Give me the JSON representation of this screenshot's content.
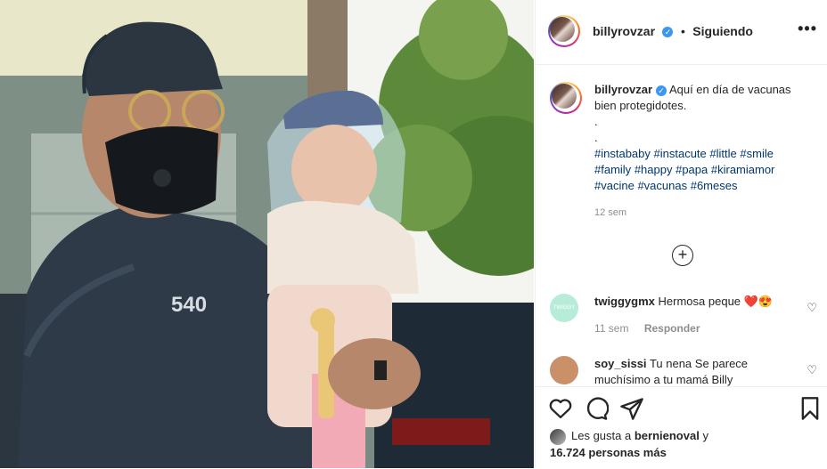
{
  "post": {
    "username": "billyrovzar",
    "follow_separator": "•",
    "follow_label": "Siguiendo",
    "more_label": "•••",
    "caption": "Aquí en día de vacunas bien protegidotes.",
    "caption_dots": [
      ".",
      "."
    ],
    "hashtags": [
      "#instababy",
      "#instacute",
      "#little",
      "#smile",
      "#family",
      "#happy",
      "#papa",
      "#kiramiamor",
      "#vacine",
      "#vacunas",
      "#6meses"
    ],
    "caption_time": "12 sem",
    "photo_text": "540"
  },
  "comments": [
    {
      "username": "twiggygmx",
      "text": "Hermosa peque",
      "emoji": "❤️😍",
      "time": "11 sem",
      "reply_label": "Responder",
      "avatar_color": "#b7ecd9",
      "avatar_text": "TWIGGY"
    },
    {
      "username": "soy_sissi",
      "text": "Tu nena Se parece muchísimo a tu mamá Billy",
      "avatar_color": "#c9906a"
    }
  ],
  "actions": {
    "icons": [
      "heart-icon",
      "comment-icon",
      "share-icon",
      "save-icon"
    ],
    "likes_prefix": "Les gusta a",
    "likes_user": "bernienoval",
    "likes_join": "y",
    "likes_count": "16.724 personas más"
  },
  "colors": {
    "accent_link": "#00376b",
    "verified": "#3897f0",
    "meta_gray": "#8e8e8e",
    "heart_red": "#ed4956"
  }
}
